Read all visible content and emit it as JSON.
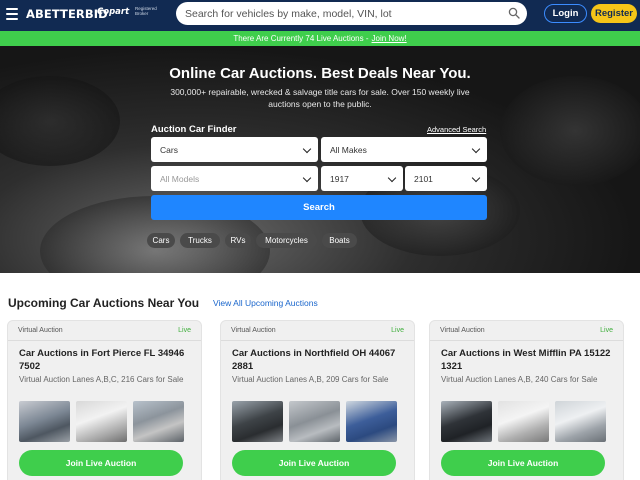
{
  "header": {
    "brand": "ABETTERBID",
    "partner": "Copart",
    "partner_sub": "Registered Broker",
    "search_placeholder": "Search for vehicles by make, model, VIN, lot",
    "login_label": "Login",
    "register_label": "Register"
  },
  "banner": {
    "text": "There Are Currently 74 Live Auctions -",
    "link": "Join Now!"
  },
  "hero": {
    "title": "Online Car Auctions. Best Deals Near You.",
    "subtitle": "300,000+ repairable, wrecked & salvage title cars for sale. Over 150 weekly live auctions open to the public.",
    "finder_title": "Auction Car Finder",
    "advanced_search": "Advanced Search",
    "vehicle_type": "Cars",
    "make": "All Makes",
    "model_placeholder": "All Models",
    "year_from": "1917",
    "year_to": "2101",
    "search_label": "Search",
    "categories": [
      "Cars",
      "Trucks",
      "RVs",
      "Motorcycles",
      "Boats"
    ]
  },
  "section": {
    "title": "Upcoming Car Auctions Near You",
    "view_all": "View All Upcoming Auctions"
  },
  "auctions": [
    {
      "type": "Virtual Auction",
      "status": "Live",
      "title": "Car Auctions in Fort Pierce FL 34946 7502",
      "desc": "Virtual Auction Lanes A,B,C, 216 Cars for Sale",
      "button": "Join Live Auction"
    },
    {
      "type": "Virtual Auction",
      "status": "Live",
      "title": "Car Auctions in Northfield OH 44067 2881",
      "desc": "Virtual Auction Lanes A,B, 209 Cars for Sale",
      "button": "Join Live Auction"
    },
    {
      "type": "Virtual Auction",
      "status": "Live",
      "title": "Car Auctions in West Mifflin PA 15122 1321",
      "desc": "Virtual Auction Lanes A,B, 240 Cars for Sale",
      "button": "Join Live Auction"
    }
  ],
  "colors": {
    "header_bg": "#112a52",
    "banner_green": "#3fce4c",
    "search_blue": "#1f86ff",
    "register_yellow": "#f5c518"
  }
}
